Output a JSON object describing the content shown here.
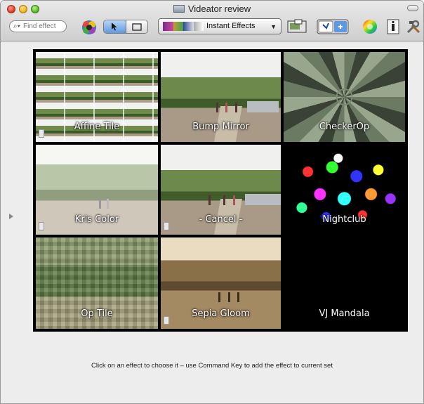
{
  "window": {
    "title": "Videator review"
  },
  "toolbar": {
    "search_placeholder": "Find effect",
    "effect_set": "Instant Effects"
  },
  "effects": [
    {
      "label": "Affine Tile"
    },
    {
      "label": "Bump Mirror"
    },
    {
      "label": "CheckerOp"
    },
    {
      "label": "Kris Color"
    },
    {
      "label": "- Cancel -"
    },
    {
      "label": "Nightclub"
    },
    {
      "label": "Op Tile"
    },
    {
      "label": "Sepia Gloom"
    },
    {
      "label": "VJ Mandala"
    }
  ],
  "hint": "Click on an effect to choose it – use Command Key to add the effect to current set",
  "colors": {
    "accent": "#5f9ae0",
    "grid_bg": "#000000",
    "window_bg": "#ececec"
  },
  "icons": [
    "search-icon",
    "gear-palette-icon",
    "pointer-icon",
    "rectangle-icon",
    "chevron-down-icon",
    "picture-in-picture-icon",
    "toggle-switch-icon",
    "color-wheel-icon",
    "info-icon",
    "tools-icon"
  ]
}
